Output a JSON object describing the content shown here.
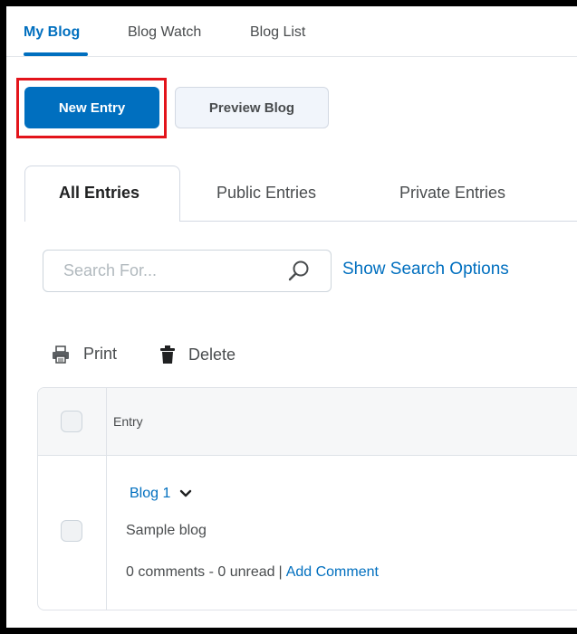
{
  "nav": {
    "tabs": [
      {
        "label": "My Blog"
      },
      {
        "label": "Blog Watch"
      },
      {
        "label": "Blog List"
      }
    ]
  },
  "actions": {
    "new_entry_label": "New Entry",
    "preview_blog_label": "Preview Blog"
  },
  "entry_tabs": [
    {
      "label": "All Entries"
    },
    {
      "label": "Public Entries"
    },
    {
      "label": "Private Entries"
    }
  ],
  "search": {
    "placeholder": "Search For...",
    "value": "",
    "options_label": "Show Search Options"
  },
  "toolbar": {
    "print_label": "Print",
    "delete_label": "Delete"
  },
  "table": {
    "column_header": "Entry",
    "rows": [
      {
        "title": "Blog 1",
        "description": "Sample blog",
        "comments": "0 comments - 0 unread",
        "separator": "|",
        "add_comment_label": "Add Comment"
      }
    ]
  },
  "icons": {
    "search": "search-icon",
    "print": "printer-icon",
    "delete": "trash-icon",
    "expand": "chevron-down-icon"
  },
  "colors": {
    "accent": "#006fbf",
    "highlight": "#e3141b",
    "text": "#494c4e"
  }
}
